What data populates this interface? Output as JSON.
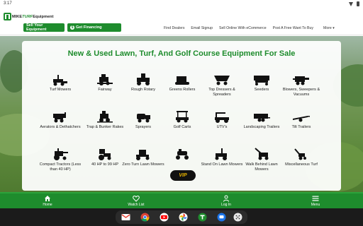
{
  "status": {
    "time": "3:17"
  },
  "header": {
    "logo_prefix": "MIKE",
    "logo_accent": "TURF",
    "logo_suffix": "Equipment",
    "sell_button": "Sell Your Equipment",
    "financing_button": "Get Financing",
    "nav": [
      "Find Dealers",
      "Email Signup",
      "Sell Online With eCommerce",
      "Post A Free Want To Buy"
    ],
    "more": "More ▾"
  },
  "main": {
    "title": "New & Used Lawn, Turf, And Golf Course Equipment For Sale",
    "categories": [
      {
        "label": "Turf Mowers",
        "icon": "turf-mower-icon"
      },
      {
        "label": "Fairway",
        "icon": "fairway-mower-icon"
      },
      {
        "label": "Rough Rotary",
        "icon": "rough-rotary-icon"
      },
      {
        "label": "Greens Rollers",
        "icon": "greens-roller-icon"
      },
      {
        "label": "Top Dressers & Spreaders",
        "icon": "top-dresser-icon"
      },
      {
        "label": "Seeders",
        "icon": "seeder-icon"
      },
      {
        "label": "Blowers, Sweepers & Vacuums",
        "icon": "blower-icon"
      },
      {
        "label": "Aerators & Dethatchers",
        "icon": "aerator-icon"
      },
      {
        "label": "Trap & Bunker Rakes",
        "icon": "bunker-rake-icon"
      },
      {
        "label": "Sprayers",
        "icon": "sprayer-icon"
      },
      {
        "label": "Golf Carts",
        "icon": "golf-cart-icon"
      },
      {
        "label": "UTV's",
        "icon": "utv-icon"
      },
      {
        "label": "Landscaping Trailers",
        "icon": "landscaping-trailer-icon"
      },
      {
        "label": "Tilt Trailers",
        "icon": "tilt-trailer-icon"
      },
      {
        "label": "Compact Tractors (Less than 40 HP)",
        "icon": "compact-tractor-icon"
      },
      {
        "label": "40 HP to 99 HP",
        "icon": "tractor-icon"
      },
      {
        "label": "Zero Turn Lawn Mowers",
        "icon": "zero-turn-mower-icon"
      },
      {
        "label": "",
        "icon": "riding-mower-icon"
      },
      {
        "label": "Stand On Lawn Mowers",
        "icon": "stand-on-mower-icon"
      },
      {
        "label": "Walk Behind Lawn Mowers",
        "icon": "walk-behind-mower-icon"
      },
      {
        "label": "Miscellaneous Turf",
        "icon": "miscellaneous-turf-icon"
      }
    ],
    "vip_badge": "VIP"
  },
  "bottom_nav": [
    {
      "label": "Home",
      "icon": "home-icon"
    },
    {
      "label": "Watch List",
      "icon": "heart-icon"
    },
    {
      "label": "Log In",
      "icon": "user-icon"
    },
    {
      "label": "Menu",
      "icon": "menu-icon"
    }
  ],
  "taskbar": {
    "apps": [
      "gmail-icon",
      "chrome-icon",
      "youtube-icon",
      "photos-icon",
      "turf-app-icon",
      "messages-icon",
      "app-drawer-icon"
    ]
  },
  "colors": {
    "brand_green": "#1e8c2d",
    "vip_gold": "#e8b400"
  }
}
